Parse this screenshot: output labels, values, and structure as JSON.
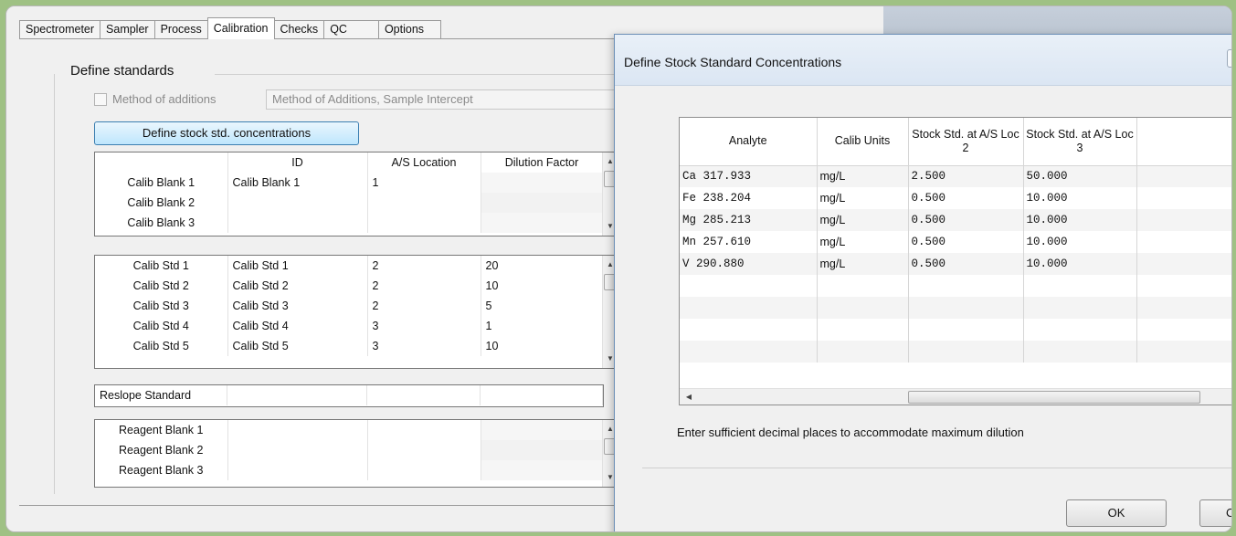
{
  "tabs": [
    "Spectrometer",
    "Sampler",
    "Process",
    "Calibration",
    "Checks",
    "QC",
    "Options"
  ],
  "active_tab": "Calibration",
  "define_standards": {
    "title": "Define standards",
    "method_of_additions_label": "Method of additions",
    "method_select_value": "Method of Additions, Sample Intercept",
    "stock_button_label": "Define stock std. concentrations"
  },
  "blank_grid": {
    "headers": [
      "",
      "ID",
      "A/S Location",
      "Dilution Factor"
    ],
    "rows": [
      {
        "name": "Calib Blank 1",
        "id": "Calib Blank 1",
        "loc": "1",
        "dil": ""
      },
      {
        "name": "Calib Blank 2",
        "id": "",
        "loc": "",
        "dil": ""
      },
      {
        "name": "Calib Blank 3",
        "id": "",
        "loc": "",
        "dil": ""
      }
    ]
  },
  "std_grid": {
    "rows": [
      {
        "name": "Calib Std 1",
        "id": "Calib Std 1",
        "loc": "2",
        "dil": "20"
      },
      {
        "name": "Calib Std 2",
        "id": "Calib Std 2",
        "loc": "2",
        "dil": "10"
      },
      {
        "name": "Calib Std 3",
        "id": "Calib Std 3",
        "loc": "2",
        "dil": "5"
      },
      {
        "name": "Calib Std 4",
        "id": "Calib Std 4",
        "loc": "3",
        "dil": "1"
      },
      {
        "name": "Calib Std 5",
        "id": "Calib Std 5",
        "loc": "3",
        "dil": "10"
      }
    ]
  },
  "reslope": {
    "name": "Reslope Standard"
  },
  "reagent_grid": {
    "rows": [
      {
        "name": "Reagent Blank 1"
      },
      {
        "name": "Reagent Blank 2"
      },
      {
        "name": "Reagent Blank 3"
      }
    ]
  },
  "dialog": {
    "title": "Define Stock Standard Concentrations",
    "help": "?",
    "headers": [
      "Analyte",
      "Calib Units",
      "Stock Std. at A/S Loc 2",
      "Stock Std. at A/S Loc 3"
    ],
    "rows": [
      {
        "analyte": "Ca 317.933",
        "units": "mg/L",
        "loc2": "2.500",
        "loc3": "50.000"
      },
      {
        "analyte": "Fe 238.204",
        "units": "mg/L",
        "loc2": "0.500",
        "loc3": "10.000"
      },
      {
        "analyte": "Mg 285.213",
        "units": "mg/L",
        "loc2": "0.500",
        "loc3": "10.000"
      },
      {
        "analyte": "Mn 257.610",
        "units": "mg/L",
        "loc2": "0.500",
        "loc3": "10.000"
      },
      {
        "analyte": "V 290.880",
        "units": "mg/L",
        "loc2": "0.500",
        "loc3": "10.000"
      }
    ],
    "hint": "Enter sufficient decimal places to accommodate maximum dilution",
    "ok_label": "OK",
    "cancel_label": "C"
  },
  "icons": {
    "scroll_up": "▲",
    "scroll_down": "▼",
    "scroll_left": "◀",
    "scroll_right": "▶",
    "dropdown": "▼"
  }
}
